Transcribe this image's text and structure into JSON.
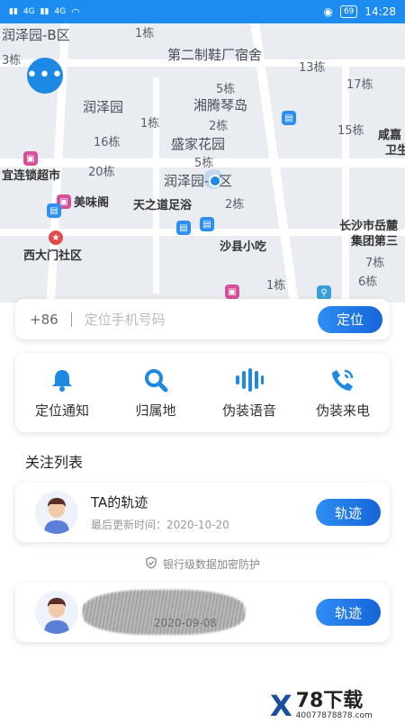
{
  "status_bar": {
    "time": "14:28",
    "battery": "69",
    "signal_left": "4G",
    "signal_right": "4G"
  },
  "map": {
    "labels": [
      "润泽园-B区",
      "第二制鞋厂宿舍",
      "润泽园",
      "湘腾琴岛",
      "盛家花园",
      "润泽园-C区",
      "宜连锁超市",
      "美味阁",
      "天之道足浴",
      "沙县小吃",
      "西大门社区",
      "长沙市岳麓",
      "集团第三",
      "咸嘉",
      "卫生"
    ],
    "building_labels": [
      "1栋",
      "3栋",
      "13栋",
      "5栋",
      "17栋",
      "1栋",
      "15栋",
      "16栋",
      "2栋",
      "20栋",
      "5栋",
      "2栋",
      "7栋",
      "6栋",
      "1栋"
    ]
  },
  "search": {
    "country_code": "+86",
    "placeholder": "定位手机号码",
    "button": "定位"
  },
  "features": [
    {
      "label": "定位通知",
      "icon": "bell-icon"
    },
    {
      "label": "归属地",
      "icon": "search-icon"
    },
    {
      "label": "伪装语音",
      "icon": "voice-wave-icon"
    },
    {
      "label": "伪装来电",
      "icon": "phone-call-icon"
    }
  ],
  "follow": {
    "title": "关注列表",
    "items": [
      {
        "name": "TA的轨迹",
        "time": "最后更新时间：2020-10-20",
        "button": "轨迹"
      },
      {
        "name": "",
        "time": "2020-09-08",
        "button": "轨迹"
      }
    ]
  },
  "security_note": "银行级数据加密防护",
  "watermark": {
    "main": "78下载",
    "sub": "40077878878.com"
  },
  "colors": {
    "primary": "#1e88e5",
    "statusbar": "#1d8cf0"
  }
}
